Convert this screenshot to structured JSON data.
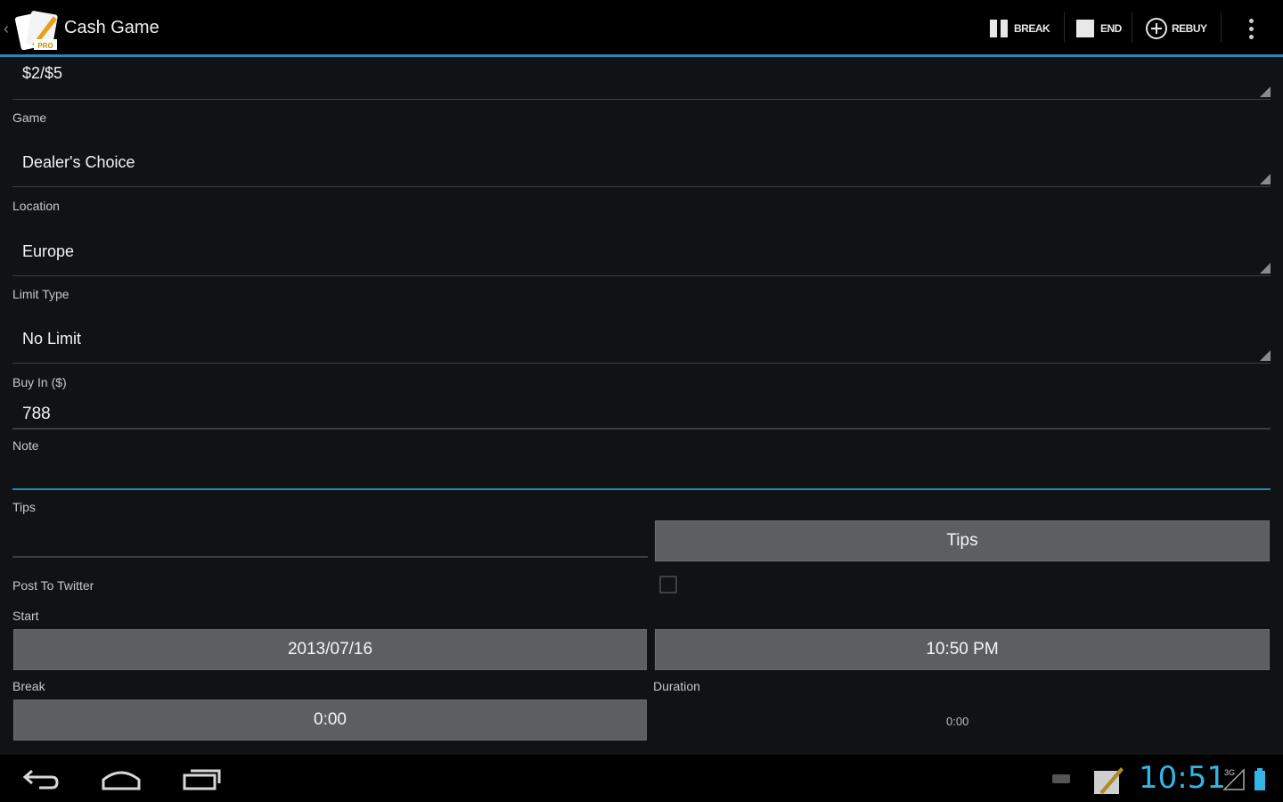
{
  "actionbar": {
    "title": "Cash Game",
    "actions": [
      {
        "label": "BREAK",
        "icon": "pause-icon"
      },
      {
        "label": "END",
        "icon": "stop-icon"
      },
      {
        "label": "REBUY",
        "icon": "plus-circle-icon"
      }
    ],
    "logo_badge": "PRO"
  },
  "form": {
    "stakes_value": "$2/$5",
    "game_label": "Game",
    "game_value": "Dealer's Choice",
    "location_label": "Location",
    "location_value": "Europe",
    "limit_label": "Limit Type",
    "limit_value": "No Limit",
    "buyin_label": "Buy In ($)",
    "buyin_value": "788",
    "note_label": "Note",
    "note_value": "",
    "tips_label": "Tips",
    "tips_value": "",
    "tips_button": "Tips",
    "twitter_label": "Post To Twitter",
    "twitter_checked": false,
    "start_label": "Start",
    "start_date": "2013/07/16",
    "start_time": "10:50 PM",
    "break_label": "Break",
    "break_value": "0:00",
    "duration_label": "Duration",
    "duration_value": "0:00"
  },
  "statusbar": {
    "clock": "10:51",
    "signal_type": "3G"
  },
  "colors": {
    "accent": "#33b5e5",
    "background": "#101214",
    "button": "#5c5f62"
  }
}
